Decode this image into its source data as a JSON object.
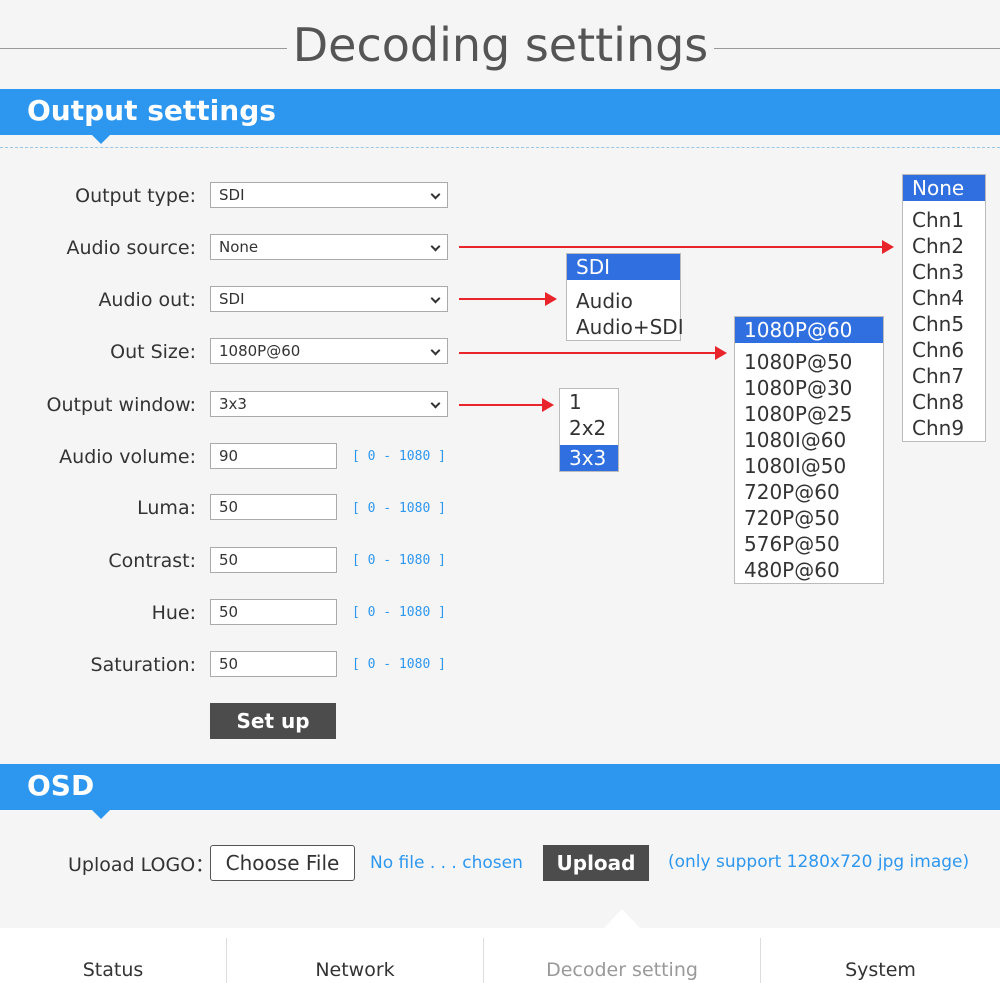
{
  "page_title": "Decoding settings",
  "output_section": {
    "title": "Output settings"
  },
  "fields": {
    "output_type": {
      "label": "Output type:",
      "value": "SDI"
    },
    "audio_source": {
      "label": "Audio source:",
      "value": "None"
    },
    "audio_out": {
      "label": "Audio out:",
      "value": "SDI"
    },
    "out_size": {
      "label": "Out Size:",
      "value": "1080P@60"
    },
    "output_window": {
      "label": "Output window:",
      "value": "3x3"
    },
    "audio_volume": {
      "label": "Audio volume:",
      "value": "90",
      "range": "[ 0 - 1080 ]"
    },
    "luma": {
      "label": "Luma:",
      "value": "50",
      "range": "[ 0 - 1080 ]"
    },
    "contrast": {
      "label": "Contrast:",
      "value": "50",
      "range": "[ 0 - 1080 ]"
    },
    "hue": {
      "label": "Hue:",
      "value": "50",
      "range": "[ 0 - 1080 ]"
    },
    "saturation": {
      "label": "Saturation:",
      "value": "50",
      "range": "[ 0 - 1080 ]"
    }
  },
  "setup_button": "Set up",
  "dropdowns": {
    "audio_source_options": [
      "None",
      "Chn1",
      "Chn2",
      "Chn3",
      "Chn4",
      "Chn5",
      "Chn6",
      "Chn7",
      "Chn8",
      "Chn9"
    ],
    "audio_out_options": [
      "SDI",
      "Audio",
      "Audio+SDI"
    ],
    "out_size_options": [
      "1080P@60",
      "1080P@50",
      "1080P@30",
      "1080P@25",
      "1080I@60",
      "1080I@50",
      "720P@60",
      "720P@50",
      "576P@50",
      "480P@60"
    ],
    "output_window_options": [
      "1",
      "2x2",
      "3x3"
    ]
  },
  "osd_section": {
    "title": "OSD",
    "upload_label": "Upload LOGO：",
    "choose_file": "Choose File",
    "no_file": "No file . . . chosen",
    "upload_button": "Upload",
    "note": "(only support 1280x720 jpg image)"
  },
  "footer_tabs": [
    "Status",
    "Network",
    "Decoder setting",
    "System"
  ],
  "colors": {
    "accent": "#2d97f0",
    "selected": "#2f6fe0",
    "arrow": "#e8232a",
    "dark_button": "#4c4c4c"
  }
}
